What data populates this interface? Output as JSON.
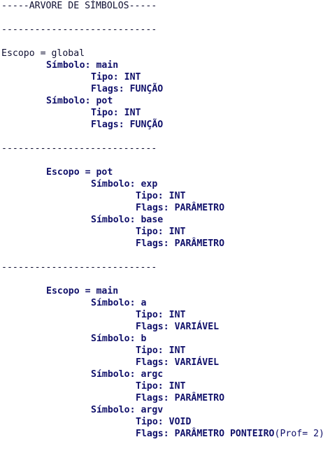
{
  "title": "-----ARVORE DE SÍMBOLOS-----",
  "separator": "----------------------------",
  "scope_label": "Escopo = ",
  "symbol_label": "Símbolo: ",
  "type_label": "Tipo: ",
  "flags_label": "Flags: ",
  "scopes": [
    {
      "name": "global",
      "symbols": [
        {
          "name": "main",
          "type": "INT",
          "flags": "FUNÇÃO"
        },
        {
          "name": "pot",
          "type": "INT",
          "flags": "FUNÇÃO"
        }
      ]
    },
    {
      "name": "pot",
      "symbols": [
        {
          "name": "exp",
          "type": "INT",
          "flags": "PARÂMETRO"
        },
        {
          "name": "base",
          "type": "INT",
          "flags": "PARÂMETRO"
        }
      ]
    },
    {
      "name": "main",
      "symbols": [
        {
          "name": "a",
          "type": "INT",
          "flags": "VARIÁVEL"
        },
        {
          "name": "b",
          "type": "INT",
          "flags": "VARIÁVEL"
        },
        {
          "name": "argc",
          "type": "INT",
          "flags": "PARÂMETRO"
        },
        {
          "name": "argv",
          "type": "VOID",
          "flags": "PARÂMETRO PONTEIRO",
          "extra": "(Prof= 2)"
        }
      ]
    }
  ]
}
